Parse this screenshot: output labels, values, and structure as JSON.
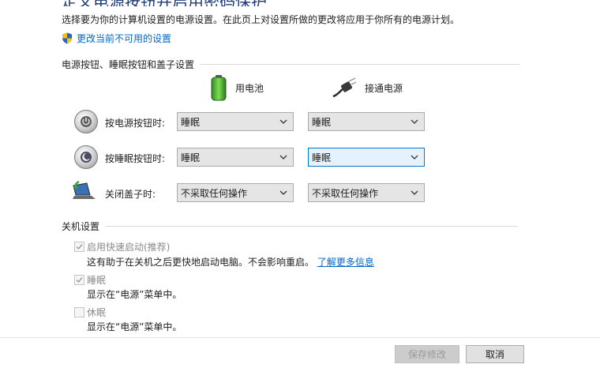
{
  "header": {
    "title_partial": "定义电源按钮并启用密码保护",
    "description": "选择要为你的计算机设置的电源设置。在此页上对设置所做的更改将应用于你所有的电源计划。",
    "change_settings_link": "更改当前不可用的设置"
  },
  "power_section": {
    "heading": "电源按钮、睡眠按钮和盖子设置",
    "columns": {
      "battery": "用电池",
      "plugged_in": "接通电源"
    },
    "rows": [
      {
        "label": "按电源按钮时:",
        "battery_value": "睡眠",
        "plugged_value": "睡眠"
      },
      {
        "label": "按睡眠按钮时:",
        "battery_value": "睡眠",
        "plugged_value": "睡眠"
      },
      {
        "label": "关闭盖子时:",
        "battery_value": "不采取任何操作",
        "plugged_value": "不采取任何操作"
      }
    ]
  },
  "shutdown_section": {
    "heading": "关机设置",
    "fast_startup": {
      "label": "启用快速启动(推荐)",
      "description": "这有助于在关机之后更快地启动电脑。不会影响重启。",
      "learn_more": "了解更多信息",
      "checked": true
    },
    "sleep": {
      "label": "睡眠",
      "description": "显示在“电源”菜单中。",
      "checked": true
    },
    "hibernate": {
      "label": "休眠",
      "description": "显示在“电源”菜单中。",
      "checked": false
    }
  },
  "footer": {
    "save_label": "保存修改",
    "cancel_label": "取消"
  },
  "colors": {
    "link": "#0066cc",
    "focus_border": "#0078d7"
  }
}
